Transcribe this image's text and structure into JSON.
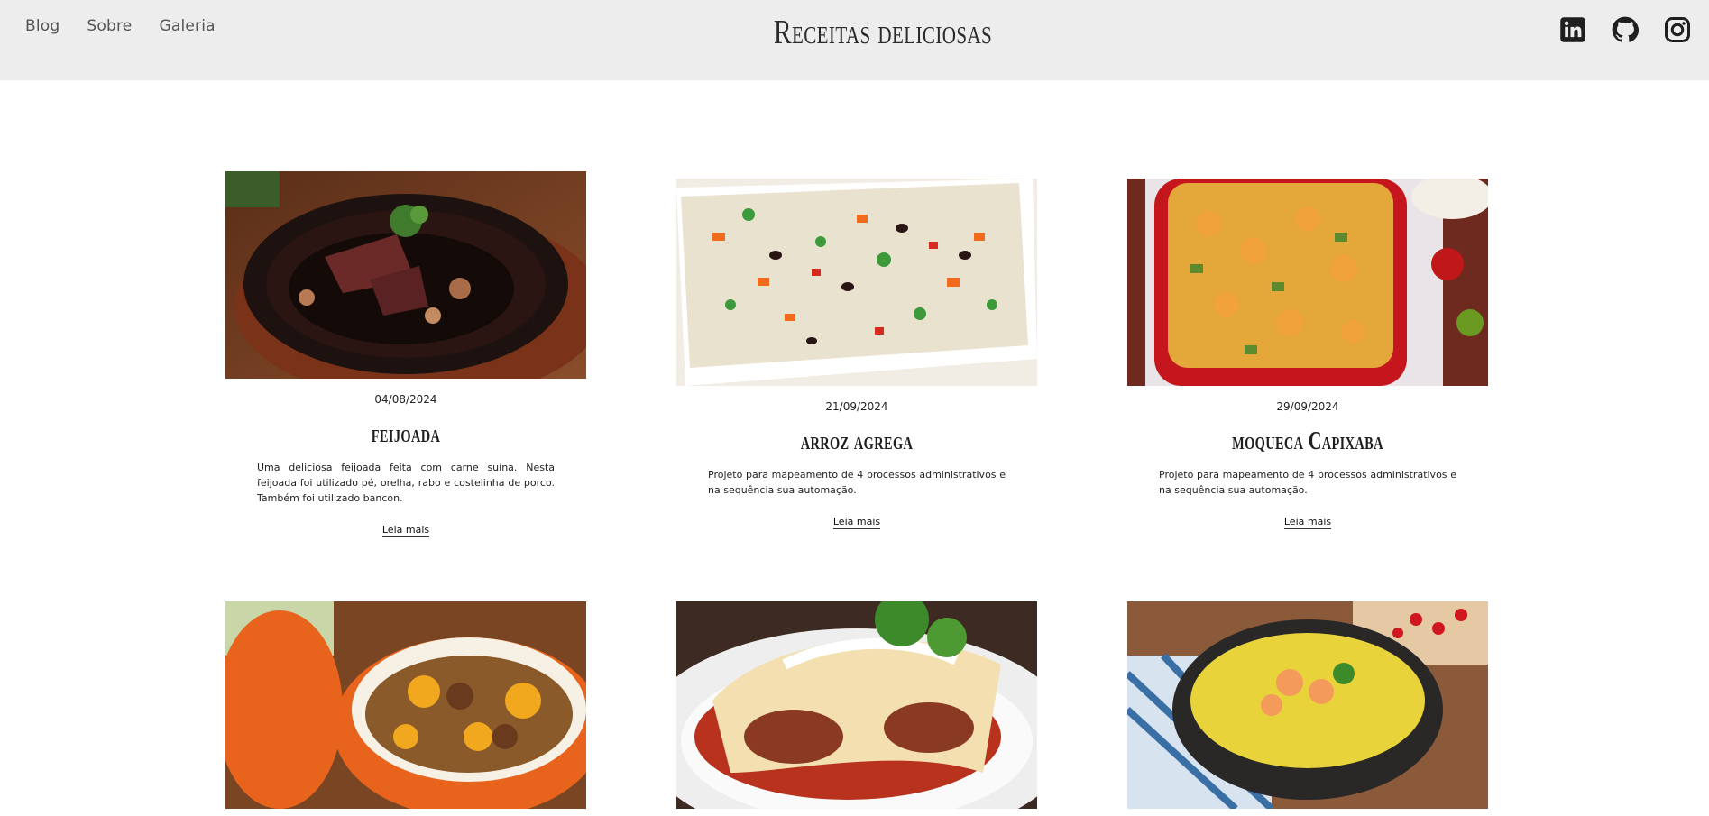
{
  "header": {
    "nav": [
      "Blog",
      "Sobre",
      "Galeria"
    ],
    "title": "Receitas deliciosas",
    "social_icons": [
      "linkedin-icon",
      "github-icon",
      "instagram-icon"
    ]
  },
  "cards": [
    {
      "date": "04/08/2024",
      "title": "feijoada",
      "desc": "Uma deliciosa feijoada feita com carne suína. Nesta feijoada foi utilizado pé, orelha, rabo e costelinha de porco. Também foi utilizado bancon.",
      "more": "Leia mais"
    },
    {
      "date": "21/09/2024",
      "title": "arroz agrega",
      "desc": "Projeto para mapeamento de 4 processos administrativos e na sequência sua automação.",
      "more": "Leia mais"
    },
    {
      "date": "29/09/2024",
      "title": "moqueca Capixaba",
      "desc": "Projeto para mapeamento de 4 processos administrativos e na sequência sua automação.",
      "more": "Leia mais"
    },
    {
      "date": "",
      "title": "",
      "desc": "",
      "more": ""
    },
    {
      "date": "",
      "title": "",
      "desc": "",
      "more": ""
    },
    {
      "date": "",
      "title": "",
      "desc": "",
      "more": ""
    }
  ],
  "colors": {
    "header_bg": "#ededed",
    "text": "#1e1e1e"
  }
}
